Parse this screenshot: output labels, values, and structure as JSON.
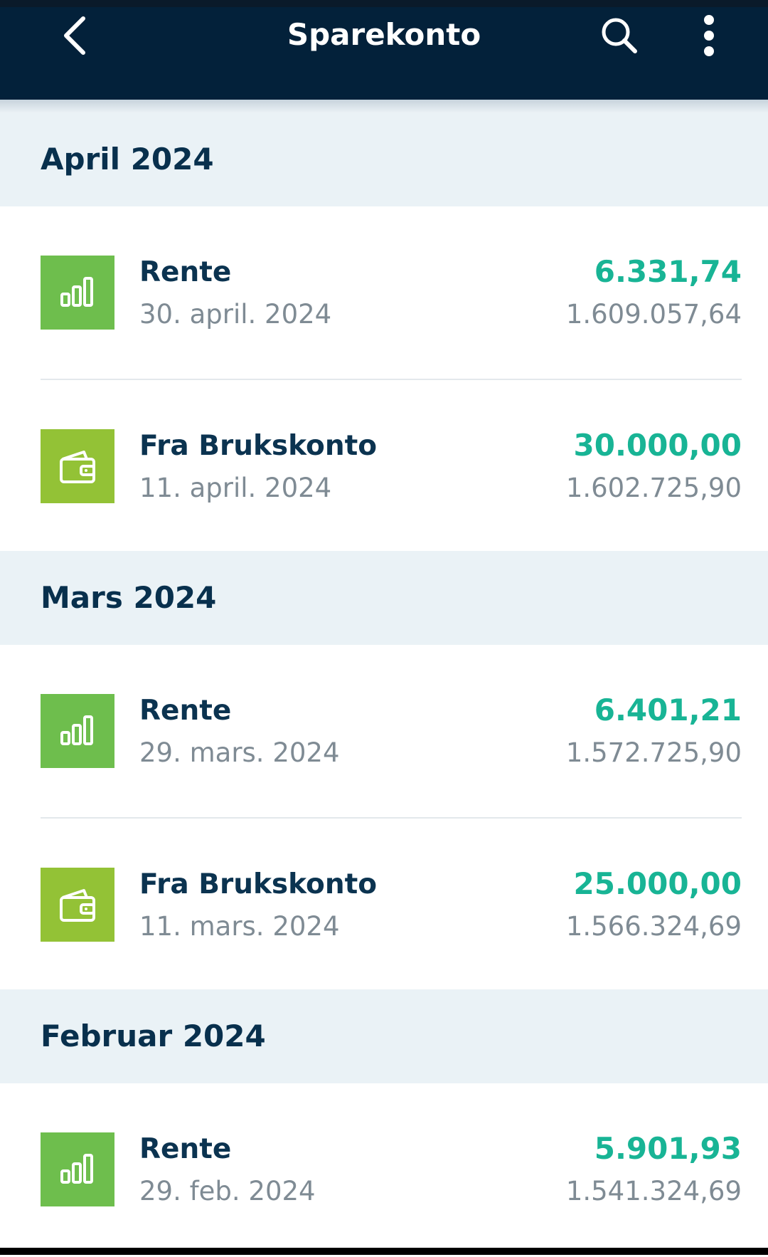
{
  "header": {
    "title": "Sparekonto",
    "back_icon": "chevron-left-icon",
    "search_icon": "search-icon",
    "more_icon": "more-vertical-icon"
  },
  "colors": {
    "header_bg": "#03213a",
    "section_bg": "#eaf2f6",
    "amount": "#18b495",
    "interest_icon_bg": "#6ebe4d",
    "transfer_icon_bg": "#93c236"
  },
  "sections": [
    {
      "month": "April 2024",
      "transactions": [
        {
          "title": "Rente",
          "date": "30. april. 2024",
          "amount": "6.331,74",
          "balance": "1.609.057,64",
          "icon": "interest-chart-icon"
        },
        {
          "title": "Fra Brukskonto",
          "date": "11. april. 2024",
          "amount": "30.000,00",
          "balance": "1.602.725,90",
          "icon": "wallet-icon"
        }
      ]
    },
    {
      "month": "Mars 2024",
      "transactions": [
        {
          "title": "Rente",
          "date": "29. mars. 2024",
          "amount": "6.401,21",
          "balance": "1.572.725,90",
          "icon": "interest-chart-icon"
        },
        {
          "title": "Fra Brukskonto",
          "date": "11. mars. 2024",
          "amount": "25.000,00",
          "balance": "1.566.324,69",
          "icon": "wallet-icon"
        }
      ]
    },
    {
      "month": "Februar 2024",
      "transactions": [
        {
          "title": "Rente",
          "date": "29. feb. 2024",
          "amount": "5.901,93",
          "balance": "1.541.324,69",
          "icon": "interest-chart-icon"
        }
      ]
    }
  ]
}
